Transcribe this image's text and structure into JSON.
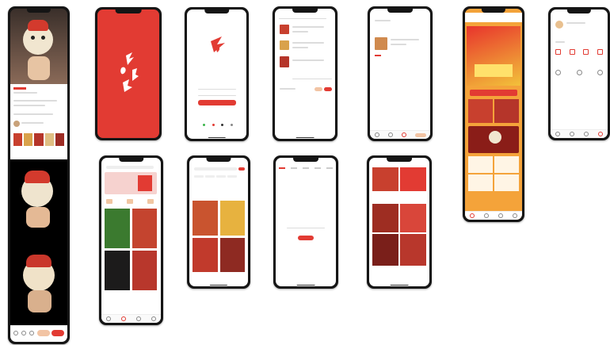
{
  "colors": {
    "brand_red": "#e23b33",
    "screen_bg": "#ffffff",
    "phone_frame": "#151515"
  },
  "screens": [
    {
      "id": "product-detail-long"
    },
    {
      "id": "splash"
    },
    {
      "id": "login"
    },
    {
      "id": "cart"
    },
    {
      "id": "order"
    },
    {
      "id": "activity-long"
    },
    {
      "id": "profile"
    },
    {
      "id": "home-feed"
    },
    {
      "id": "search"
    },
    {
      "id": "empty-state"
    },
    {
      "id": "category-feed"
    }
  ]
}
